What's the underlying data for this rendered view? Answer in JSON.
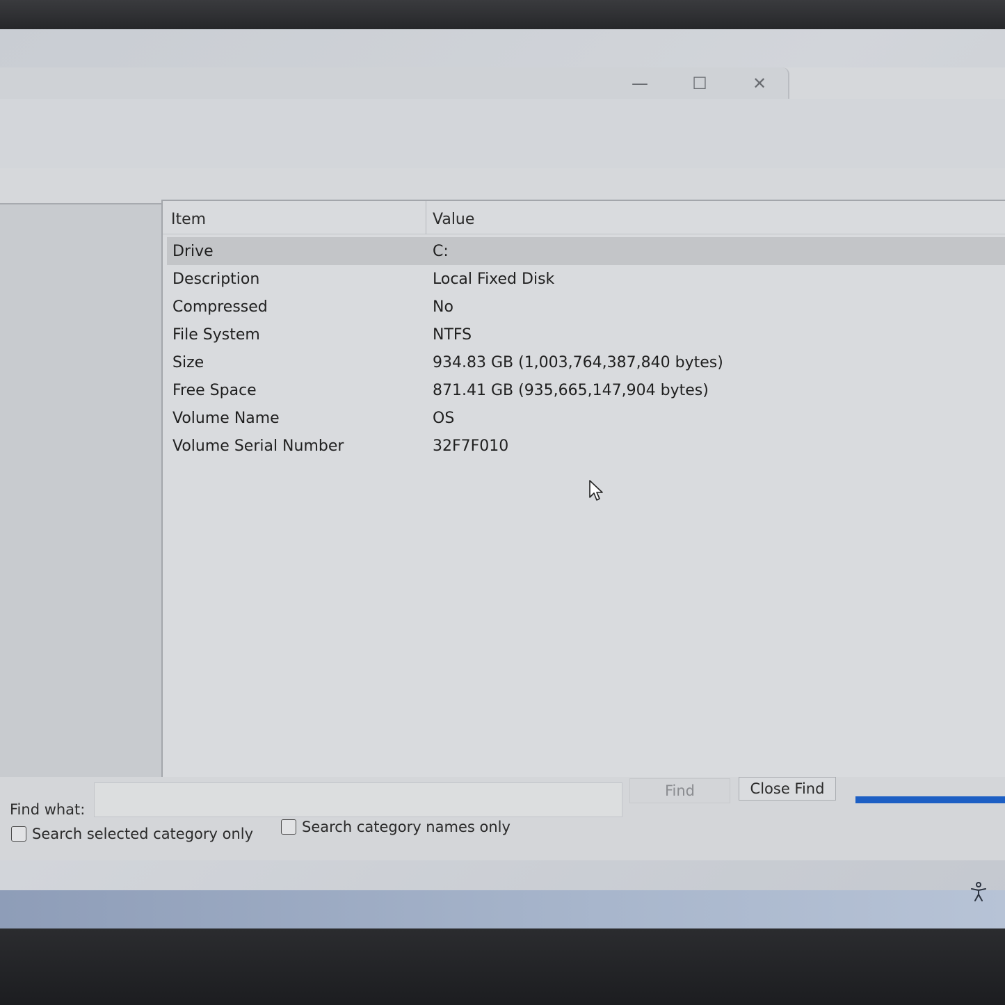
{
  "window": {
    "title": "",
    "minimize_symbol": "—",
    "maximize_symbol": "☐",
    "close_symbol": "✕"
  },
  "list": {
    "columns": {
      "item": "Item",
      "value": "Value"
    },
    "rows": [
      {
        "item": "Drive",
        "value": "C:"
      },
      {
        "item": "Description",
        "value": "Local Fixed Disk"
      },
      {
        "item": "Compressed",
        "value": "No"
      },
      {
        "item": "File System",
        "value": "NTFS"
      },
      {
        "item": "Size",
        "value": "934.83 GB (1,003,764,387,840 bytes)"
      },
      {
        "item": "Free Space",
        "value": "871.41 GB (935,665,147,904 bytes)"
      },
      {
        "item": "Volume Name",
        "value": "OS"
      },
      {
        "item": "Volume Serial Number",
        "value": "32F7F010"
      }
    ],
    "selected_row": "Drive"
  },
  "find": {
    "label": "Find what:",
    "input_value": "",
    "find_button": "Find",
    "close_find_button": "Close Find",
    "check_selected_category": "Search selected category only",
    "check_category_names": "Search category names only"
  },
  "icons": {
    "accessibility": "accessibility-icon",
    "cursor": "mouse-pointer-icon"
  },
  "colors": {
    "accent": "#1d5fc4"
  }
}
